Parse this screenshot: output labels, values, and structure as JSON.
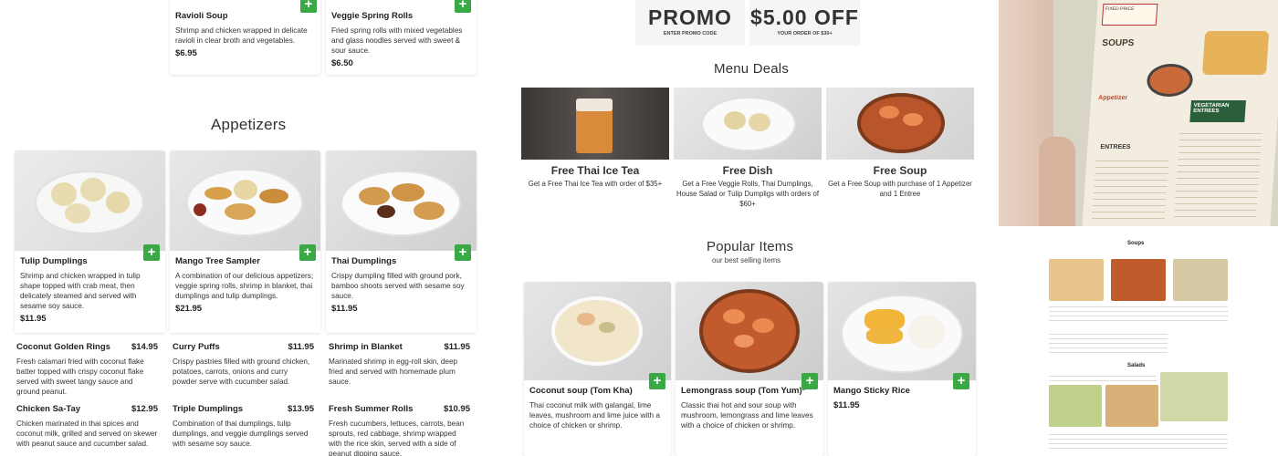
{
  "top_items": [
    {
      "name": "Ravioli Soup",
      "description": "Shrimp and chicken wrapped in delicate ravioli in clear broth and vegetables.",
      "price": "$6.95"
    },
    {
      "name": "Veggie Spring Rolls",
      "description": "Fried spring rolls with mixed vegetables and glass noodles served with sweet & sour sauce.",
      "price": "$6.50"
    }
  ],
  "appetizers": {
    "title": "Appetizers",
    "cards": [
      {
        "name": "Tulip Dumplings",
        "description": "Shrimp and chicken wrapped in tulip shape topped with crab meat, then delicately steamed and served with sesame soy sauce.",
        "price": "$11.95"
      },
      {
        "name": "Mango Tree Sampler",
        "description": "A combination of our delicious appetizers; veggie spring rolls, shrimp in blanket, thai dumplings and tulip dumplings.",
        "price": "$21.95"
      },
      {
        "name": "Thai Dumplings",
        "description": "Crispy dumpling filled with ground pork, bamboo shoots served with sesame soy sauce.",
        "price": "$11.95"
      }
    ],
    "list": [
      {
        "name": "Coconut Golden Rings",
        "price": "$14.95",
        "description": "Fresh calamari fried with coconut flake batter topped with crispy coconut flake served with sweet tangy sauce and ground peanut."
      },
      {
        "name": "Curry Puffs",
        "price": "$11.95",
        "description": "Crispy pastries filled with ground chicken, potatoes, carrots, onions and curry powder serve with cucumber salad."
      },
      {
        "name": "Shrimp in Blanket",
        "price": "$11.95",
        "description": "Marinated shrimp in egg-roll skin, deep fried and served with homemade plum sauce."
      },
      {
        "name": "Chicken Sa-Tay",
        "price": "$12.95",
        "description": "Chicken marinated in thai spices and coconut milk, grilled and served on skewer with peanut sauce and cucumber salad."
      },
      {
        "name": "Triple Dumplings",
        "price": "$13.95",
        "description": "Combination of thai dumplings, tulip dumplings, and veggie dumplings served with sesame soy sauce."
      },
      {
        "name": "Fresh Summer Rolls",
        "price": "$10.95",
        "description": "Fresh cucumbers, lettuces, carrots, bean sprouts, red cabbage, shrimp wrapped with the rice skin, served with a side of peanut dipping sauce."
      }
    ]
  },
  "promo": {
    "code": "PROMO",
    "code_caption": "ENTER PROMO CODE",
    "offer": "$5.00 OFF",
    "offer_caption": "YOUR ORDER OF $30+"
  },
  "menu_deals": {
    "title": "Menu Deals",
    "deals": [
      {
        "title": "Free Thai Ice Tea",
        "description": "Get a Free Thai Ice Tea with order of $35+"
      },
      {
        "title": "Free Dish",
        "description": "Get a Free Veggie Rolls, Thai Dumplings, House Salad or Tulip Dumpligs with orders of $60+"
      },
      {
        "title": "Free Soup",
        "description": "Get a Free Soup with purchase of 1 Appetizer and 1 Entree"
      }
    ]
  },
  "popular": {
    "title": "Popular Items",
    "subtitle": "our best selling items",
    "cards": [
      {
        "name": "Coconut soup (Tom Kha)",
        "description": "Thai coconut milk with galangal, lime leaves, mushroom and lime juice with a choice of chicken or shrimp."
      },
      {
        "name": "Lemongrass soup (Tom Yum)*",
        "description": "Classic thai hot and sour soup with mushroom, lemongrass and lime leaves with a choice of chicken or shrimp."
      },
      {
        "name": "Mango Sticky Rice",
        "price": "$11.95"
      }
    ]
  },
  "menu_photo": {
    "visible_words": [
      "FIXED PRICE",
      "SOUPS",
      "VEGETARIAN ENTREES",
      "ENTREES",
      "Appetizer"
    ]
  },
  "menu_page": {
    "sections": [
      "Soups",
      "Salads"
    ]
  },
  "colors": {
    "accent": "#3aa845",
    "text": "#222222",
    "promo_bg": "#f5f5f5"
  }
}
